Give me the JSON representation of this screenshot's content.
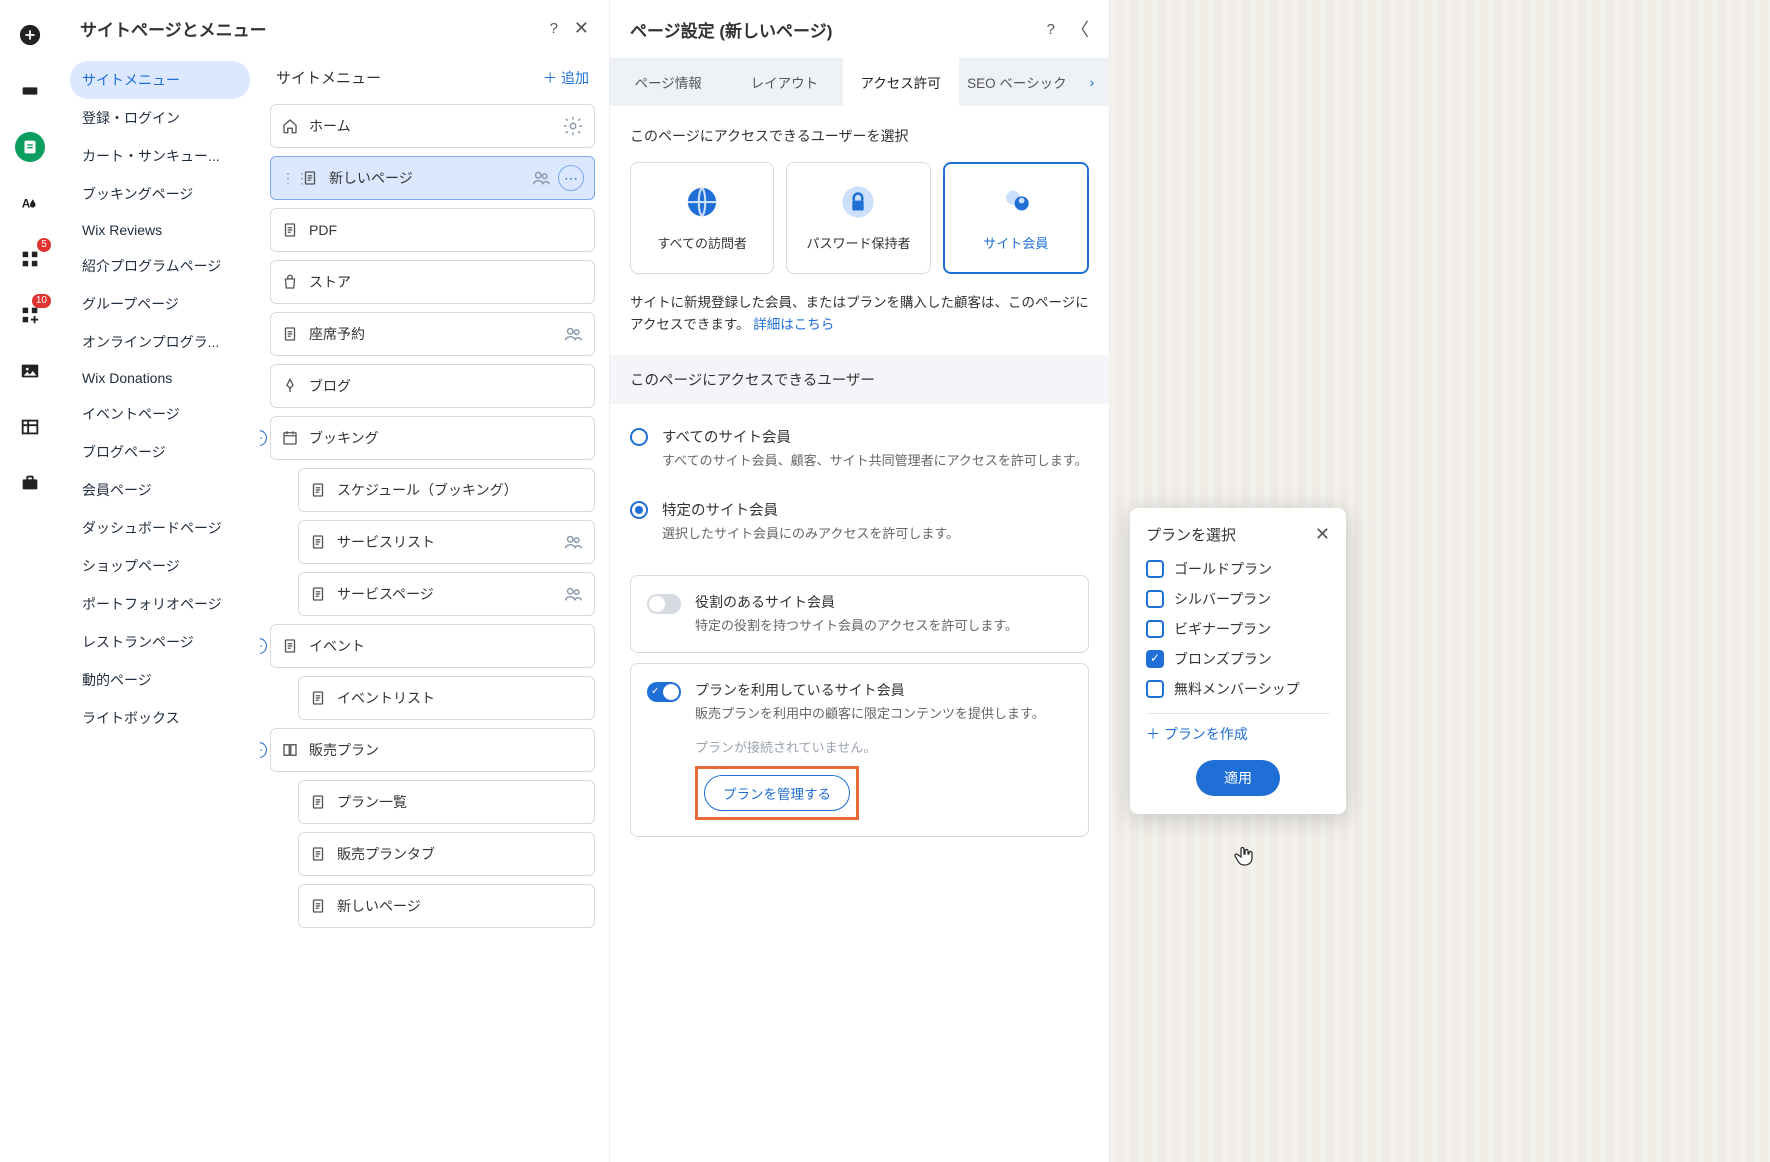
{
  "iconRail": {
    "badges": {
      "apps": "5",
      "appmarket": "10"
    }
  },
  "panel1": {
    "title": "サイトページとメニュー",
    "menu": {
      "items": [
        "サイトメニュー",
        "登録・ログイン",
        "カート・サンキュー...",
        "ブッキングページ",
        "Wix Reviews",
        "紹介プログラムページ",
        "グループページ",
        "オンラインプログラ...",
        "Wix Donations",
        "イベントページ",
        "ブログページ",
        "会員ページ",
        "ダッシュボードページ",
        "ショップページ",
        "ポートフォリオページ",
        "レストランページ",
        "動的ページ",
        "ライトボックス"
      ],
      "selectedIndex": 0
    },
    "tree": {
      "headerTitle": "サイトメニュー",
      "addLabel": "＋ 追加",
      "items": [
        {
          "label": "ホーム",
          "icon": "home",
          "actions": [
            "settings"
          ]
        },
        {
          "label": "新しいページ",
          "icon": "page",
          "selected": true,
          "drag": true,
          "actions": [
            "members",
            "more"
          ]
        },
        {
          "label": "PDF",
          "icon": "page"
        },
        {
          "label": "ストア",
          "icon": "bag"
        },
        {
          "label": "座席予約",
          "icon": "page",
          "actions": [
            "members"
          ]
        },
        {
          "label": "ブログ",
          "icon": "pen"
        },
        {
          "label": "ブッキング",
          "icon": "calendar",
          "toggle": true
        },
        {
          "label": "スケジュール（ブッキング）",
          "icon": "page",
          "child": true
        },
        {
          "label": "サービスリスト",
          "icon": "page",
          "child": true,
          "actions": [
            "members"
          ]
        },
        {
          "label": "サービスページ",
          "icon": "page",
          "child": true,
          "actions": [
            "members"
          ]
        },
        {
          "label": "イベント",
          "icon": "page",
          "toggle": true
        },
        {
          "label": "イベントリスト",
          "icon": "page",
          "child": true
        },
        {
          "label": "販売プラン",
          "icon": "plans",
          "toggle": true
        },
        {
          "label": "プラン一覧",
          "icon": "page",
          "child": true
        },
        {
          "label": "販売プランタブ",
          "icon": "page",
          "child": true
        },
        {
          "label": "新しいページ",
          "icon": "page",
          "child": true
        }
      ]
    }
  },
  "panel2": {
    "title": "ページ設定 (新しいページ)",
    "tabs": [
      "ページ情報",
      "レイアウト",
      "アクセス許可",
      "SEO ベーシック"
    ],
    "activeTab": 2,
    "access": {
      "prompt": "このページにアクセスできるユーザーを選択",
      "cards": [
        {
          "label": "すべての訪問者",
          "icon": "globe"
        },
        {
          "label": "パスワード保持者",
          "icon": "lock"
        },
        {
          "label": "サイト会員",
          "icon": "member",
          "selected": true
        }
      ],
      "descText": "サイトに新規登録した会員、またはプランを購入した顧客は、このページにアクセスできます。",
      "descLink": "詳細はこちら"
    },
    "usersSection": {
      "header": "このページにアクセスできるユーザー",
      "options": [
        {
          "title": "すべてのサイト会員",
          "desc": "すべてのサイト会員、顧客、サイト共同管理者にアクセスを許可します。"
        },
        {
          "title": "特定のサイト会員",
          "desc": "選択したサイト会員にのみアクセスを許可します。",
          "selected": true
        }
      ]
    },
    "toggles": [
      {
        "title": "役割のあるサイト会員",
        "desc": "特定の役割を持つサイト会員のアクセスを許可します。",
        "on": false
      },
      {
        "title": "プランを利用しているサイト会員",
        "desc": "販売プランを利用中の顧客に限定コンテンツを提供します。",
        "on": true,
        "warnText": "プランが接続されていません。",
        "buttonLabel": "プランを管理する"
      }
    ]
  },
  "planPopup": {
    "title": "プランを選択",
    "options": [
      {
        "label": "ゴールドプラン",
        "checked": false
      },
      {
        "label": "シルバープラン",
        "checked": false
      },
      {
        "label": "ビギナープラン",
        "checked": false
      },
      {
        "label": "ブロンズプラン",
        "checked": true
      },
      {
        "label": "無料メンバーシップ",
        "checked": false
      }
    ],
    "createLabel": "＋ プランを作成",
    "applyLabel": "適用"
  }
}
